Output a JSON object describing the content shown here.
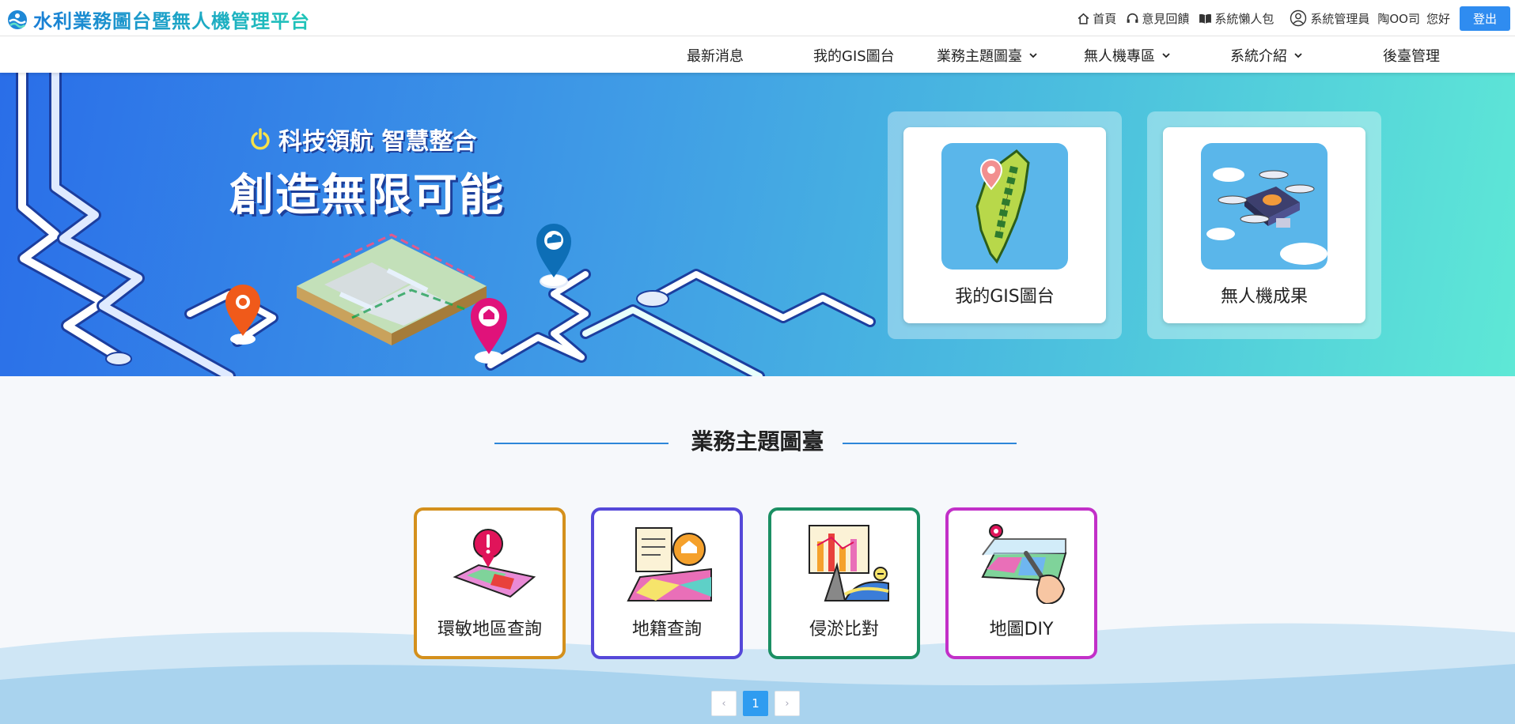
{
  "header": {
    "site_title": "水利業務圖台暨無人機管理平台",
    "links": [
      {
        "label": "首頁",
        "icon": "home-icon"
      },
      {
        "label": "意見回饋",
        "icon": "headset-icon"
      },
      {
        "label": "系統懶人包",
        "icon": "book-icon"
      }
    ],
    "user_role": "系統管理員",
    "user_name": "陶OO司",
    "greeting": "您好",
    "logout_label": "登出"
  },
  "nav": {
    "items": [
      {
        "label": "最新消息",
        "has_dropdown": false
      },
      {
        "label": "我的GIS圖台",
        "has_dropdown": false
      },
      {
        "label": "業務主題圖臺",
        "has_dropdown": true
      },
      {
        "label": "無人機專區",
        "has_dropdown": true
      },
      {
        "label": "系統介紹",
        "has_dropdown": true
      },
      {
        "label": "後臺管理",
        "has_dropdown": false
      }
    ]
  },
  "hero": {
    "slogan_small": "科技領航 智慧整合",
    "slogan_big": "創造無限可能",
    "cards": [
      {
        "label": "我的GIS圖台",
        "icon": "taiwan-map-icon"
      },
      {
        "label": "無人機成果",
        "icon": "drone-icon"
      }
    ]
  },
  "themes": {
    "title": "業務主題圖臺",
    "items": [
      {
        "label": "環敏地區查詢",
        "icon": "sensitive-area-icon",
        "border": "#d4901c"
      },
      {
        "label": "地籍查詢",
        "icon": "cadastral-icon",
        "border": "#5548d9"
      },
      {
        "label": "侵淤比對",
        "icon": "erosion-compare-icon",
        "border": "#1b8f63"
      },
      {
        "label": "地圖DIY",
        "icon": "map-diy-icon",
        "border": "#c230c8"
      }
    ]
  },
  "pagination": {
    "prev": "‹",
    "current": "1",
    "next": "›"
  },
  "colors": {
    "primary": "#2f8cf0",
    "brand_start": "#1a7fd6",
    "brand_end": "#1fc5b8"
  }
}
